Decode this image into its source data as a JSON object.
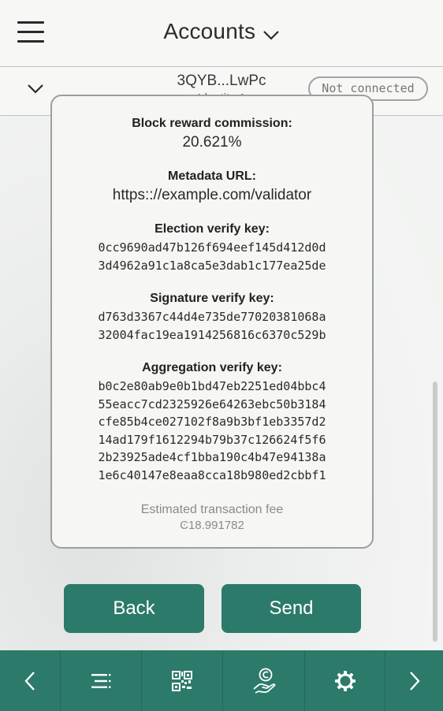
{
  "header": {
    "title": "Accounts",
    "menu_icon": "hamburger-menu-icon",
    "title_dropdown_icon": "chevron-down-icon"
  },
  "account": {
    "address": "3QYB...LwPc",
    "identity": "Identity 1",
    "connection_status": "Not connected",
    "expand_icon": "chevron-down-icon"
  },
  "details": {
    "commission_label": "Block reward commission:",
    "commission_value": "20.621%",
    "metadata_label": "Metadata URL:",
    "metadata_value": "https:://example.com/validator",
    "election_label": "Election verify key:",
    "election_lines": [
      "0cc9690ad47b126f694eef145d412d0d",
      "3d4962a91c1a8ca5e3dab1c177ea25de"
    ],
    "signature_label": "Signature verify key:",
    "signature_lines": [
      "d763d3367c44d4e735de77020381068a",
      "32004fac19ea1914256816c6370c529b"
    ],
    "aggregation_label": "Aggregation verify key:",
    "aggregation_lines": [
      "b0c2e80ab9e0b1bd47eb2251ed04bbc4",
      "55eacc7cd2325926e64263ebc50b3184",
      "cfe85b4ce027102f8a9b3bf1eb3357d2",
      "14ad179f1612294b79b37c126624f5f6",
      "2b23925ade4cf1bba190c4b47e94138a",
      "1e6c40147e8eaa8cca18b980ed2cbbf1"
    ],
    "fee_label": "Estimated transaction fee",
    "fee_value": "Ͼ18.991782"
  },
  "actions": {
    "back_label": "Back",
    "send_label": "Send"
  },
  "bottom_nav": {
    "items": [
      "chevron-left-icon",
      "transactions-list-icon",
      "qr-code-icon",
      "staking-hand-icon",
      "settings-gear-icon",
      "chevron-right-icon"
    ]
  },
  "colors": {
    "accent": "#2c7a6a",
    "background": "#f1f2f1",
    "card": "#f6f6f5"
  }
}
